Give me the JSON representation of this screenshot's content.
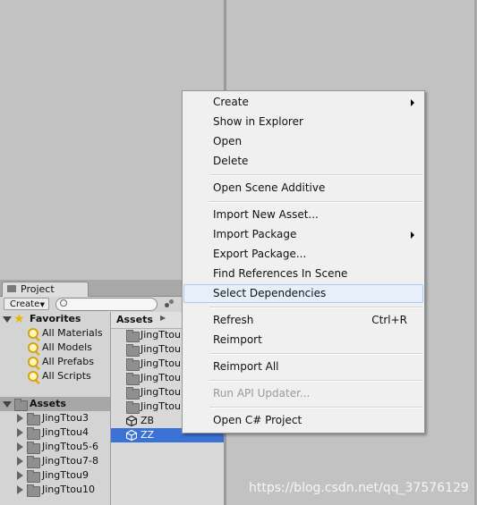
{
  "project_window": {
    "tab_label": "Project",
    "create_label": "Create",
    "search_value": ""
  },
  "favorites": {
    "title": "Favorites",
    "items": [
      "All Materials",
      "All Models",
      "All Prefabs",
      "All Scripts"
    ]
  },
  "assets_tree": {
    "title": "Assets",
    "items": [
      "JingTtou3",
      "JingTtou4",
      "JingTtou5-6",
      "JingTtou7-8",
      "JingTtou9",
      "JingTtou10"
    ]
  },
  "assets_pane": {
    "breadcrumb": "Assets",
    "folders": [
      "JingTtou",
      "JingTtou",
      "JingTtou",
      "JingTtou",
      "JingTtou",
      "JingTtou"
    ],
    "scenes": [
      "ZB",
      "ZZ"
    ],
    "selected": "ZZ"
  },
  "context_menu": {
    "items": [
      {
        "label": "Create",
        "submenu": true
      },
      {
        "label": "Show in Explorer"
      },
      {
        "label": "Open"
      },
      {
        "label": "Delete"
      },
      {
        "label": "Open Scene Additive"
      },
      {
        "label": "Import New Asset..."
      },
      {
        "label": "Import Package",
        "submenu": true
      },
      {
        "label": "Export Package..."
      },
      {
        "label": "Find References In Scene"
      },
      {
        "label": "Select Dependencies",
        "highlighted": true
      },
      {
        "label": "Refresh",
        "shortcut": "Ctrl+R"
      },
      {
        "label": "Reimport"
      },
      {
        "label": "Reimport All"
      },
      {
        "label": "Run API Updater...",
        "disabled": true
      },
      {
        "label": "Open C# Project"
      }
    ]
  },
  "watermark": "https://blog.csdn.net/qq_37576129",
  "colors": {
    "selection": "#3a72d6",
    "menu_highlight": "#e5f0fb",
    "panel": "#c2c2c2"
  }
}
